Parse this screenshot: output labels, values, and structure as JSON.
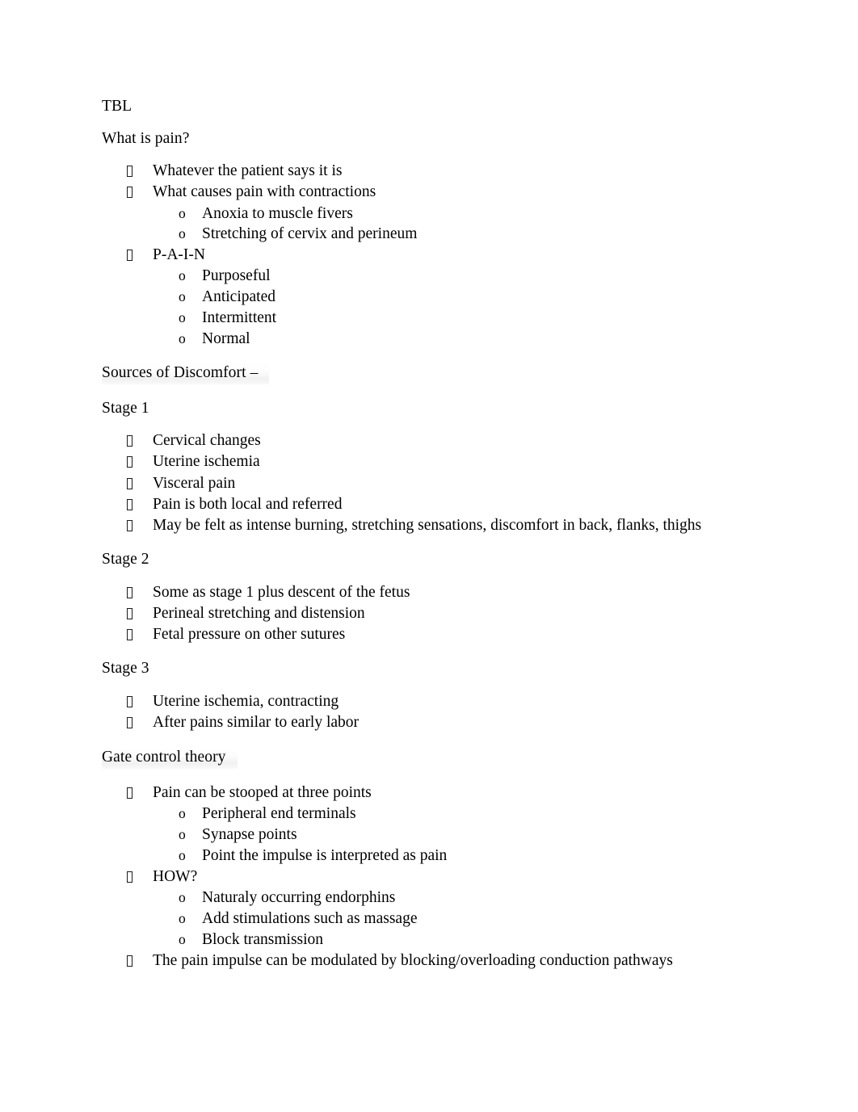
{
  "document": {
    "title": "TBL",
    "bullet_glyph": "",
    "sub_bullet_glyph": "o",
    "blocks": [
      {
        "kind": "para",
        "text": "TBL"
      },
      {
        "kind": "para",
        "text": "What is pain?"
      },
      {
        "kind": "li1",
        "text": "Whatever the patient says it is"
      },
      {
        "kind": "li1",
        "text": "What causes pain with contractions"
      },
      {
        "kind": "li2",
        "text": "Anoxia to muscle fivers"
      },
      {
        "kind": "li2",
        "text": "Stretching of cervix and perineum"
      },
      {
        "kind": "li1",
        "text": "P-A-I-N"
      },
      {
        "kind": "li2",
        "text": "Purposeful"
      },
      {
        "kind": "li2",
        "text": "Anticipated"
      },
      {
        "kind": "li2",
        "text": "Intermittent"
      },
      {
        "kind": "li2",
        "text": "Normal"
      },
      {
        "kind": "shaded",
        "text": "Sources of Discomfort –"
      },
      {
        "kind": "para",
        "text": "Stage 1"
      },
      {
        "kind": "li1",
        "text": "Cervical changes"
      },
      {
        "kind": "li1",
        "text": "Uterine ischemia"
      },
      {
        "kind": "li1",
        "text": "Visceral pain"
      },
      {
        "kind": "li1",
        "text": "Pain is both local and referred"
      },
      {
        "kind": "li1",
        "text": "May be felt as intense burning, stretching sensations, discomfort in back, flanks, thighs"
      },
      {
        "kind": "para",
        "text": "Stage 2"
      },
      {
        "kind": "li1",
        "text": "Some as stage 1 plus descent of the fetus"
      },
      {
        "kind": "li1",
        "text": "Perineal stretching and distension"
      },
      {
        "kind": "li1",
        "text": "Fetal pressure on other sutures"
      },
      {
        "kind": "para",
        "text": "Stage 3"
      },
      {
        "kind": "li1",
        "text": "Uterine ischemia, contracting"
      },
      {
        "kind": "li1",
        "text": "After pains similar to early labor"
      },
      {
        "kind": "shaded",
        "text": "Gate control theory"
      },
      {
        "kind": "li1",
        "text": "Pain can be stooped at three points"
      },
      {
        "kind": "li2",
        "text": "Peripheral end terminals"
      },
      {
        "kind": "li2",
        "text": "Synapse points"
      },
      {
        "kind": "li2",
        "text": "Point the impulse is interpreted as pain"
      },
      {
        "kind": "li1",
        "text": "HOW?"
      },
      {
        "kind": "li2",
        "text": "Naturaly occurring endorphins"
      },
      {
        "kind": "li2",
        "text": "Add stimulations such as massage"
      },
      {
        "kind": "li2",
        "text": "Block transmission"
      },
      {
        "kind": "li1",
        "text": "The pain impulse can be modulated by blocking/overloading conduction pathways"
      }
    ]
  },
  "colors": {
    "page_background": "#ffffff",
    "text": "#000000",
    "shading": "#f1f1f1"
  }
}
